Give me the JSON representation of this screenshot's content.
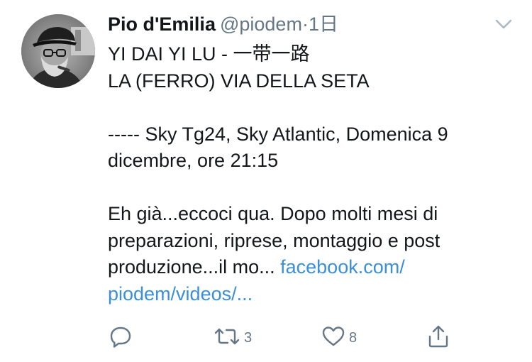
{
  "tweet": {
    "display_name": "Pio d'Emilia",
    "handle": "@piodem",
    "separator": "·",
    "time": "1日",
    "lines": [
      "YI DAI YI LU  - 一带一路",
      "LA (FERRO) VIA DELLA SETA",
      "",
      "----- Sky Tg24, Sky Atlantic, Domenica 9",
      "dicembre, ore 21:15",
      "",
      "Eh già...eccoci qua. Dopo molti mesi di",
      "preparazioni, riprese, montaggio e post"
    ],
    "last_line_text": "produzione...il mo... ",
    "link_part1": "facebook.com/",
    "link_part2": "piodem/videos/..."
  },
  "actions": {
    "reply_icon": "reply-icon",
    "retweet_icon": "retweet-icon",
    "retweet_count": "3",
    "like_icon": "heart-icon",
    "like_count": "8",
    "share_icon": "share-icon"
  },
  "colors": {
    "text": "#14171a",
    "secondary": "#657786",
    "link": "#3b8fd9"
  }
}
